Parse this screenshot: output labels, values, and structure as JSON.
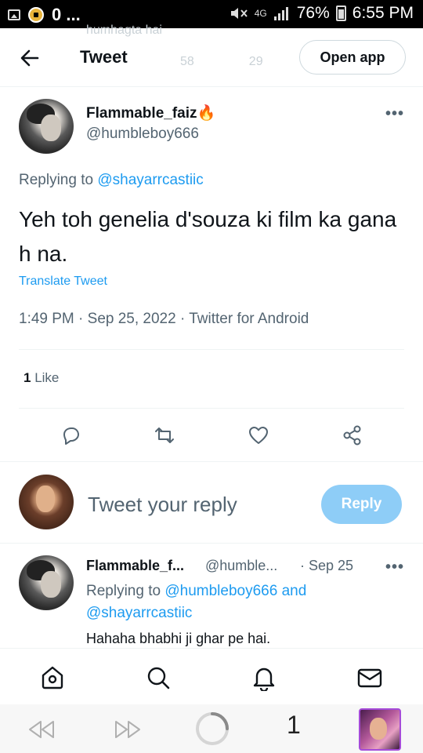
{
  "status_bar": {
    "left_text": "0 ...",
    "network": "4G",
    "battery": "76%",
    "time": "6:55 PM"
  },
  "header": {
    "title": "Tweet",
    "open_app_label": "Open app",
    "background_partial_text": "humhagta hai",
    "background_partial_retweets": "58",
    "background_partial_likes": "29"
  },
  "main_tweet": {
    "author_name": "Flammable_faiz",
    "author_emoji": "🔥",
    "author_handle": "@humbleboy666",
    "more_label": "•••",
    "replying_prefix": "Replying to",
    "replying_to": "@shayarrcastiic",
    "text": "Yeh toh genelia d'souza ki film ka gana h na.",
    "translate_label": "Translate Tweet",
    "meta": "1:49 PM · Sep 25, 2022 · Twitter for Android",
    "like_count": "1",
    "like_label": "Like"
  },
  "composer": {
    "placeholder": "Tweet your reply",
    "reply_button": "Reply"
  },
  "reply_tweet": {
    "author_name": "Flammable_f...",
    "author_handle": "@humble...",
    "date": "· Sep 25",
    "more_label": "•••",
    "replying_prefix": "Replying to",
    "replying_to_1": "@humbleboy666",
    "replying_and": "and",
    "replying_to_2": "@shayarrcastiic",
    "text": "Hahaha bhabhi ji ghar pe hai."
  },
  "bottom_nav": {
    "items": [
      "home-icon",
      "search-icon",
      "notifications-icon",
      "messages-icon"
    ]
  },
  "browser_bar": {
    "tab_count": "1"
  },
  "colors": {
    "accent": "#1d9bf0",
    "reply_button_disabled": "#8ecdf7",
    "muted_text": "#536471",
    "primary_text": "#0f1419"
  }
}
